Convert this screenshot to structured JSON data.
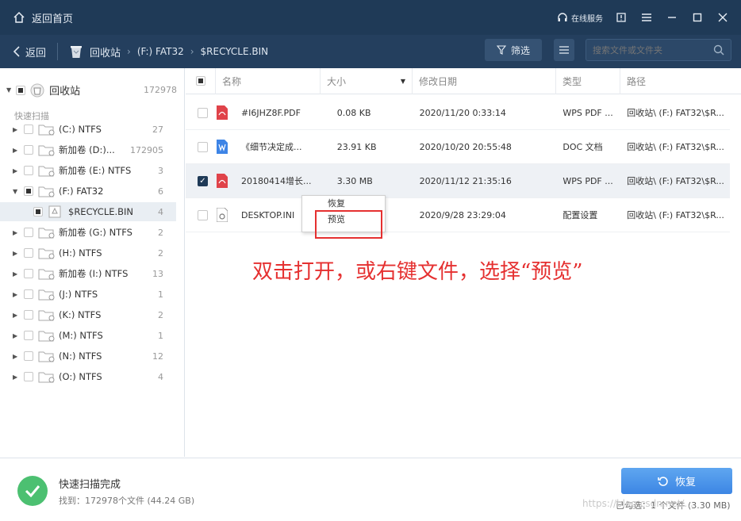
{
  "titlebar": {
    "home_label": "返回首页",
    "service_label": "在线服务"
  },
  "toolbar": {
    "back_label": "返回",
    "crumbs": [
      "回收站",
      "(F:) FAT32",
      "$RECYCLE.BIN"
    ],
    "filter_label": "筛选",
    "search_placeholder": "搜索文件或文件夹"
  },
  "sidebar": {
    "root": {
      "label": "回收站",
      "count": "172978"
    },
    "quick_scan_label": "快速扫描",
    "nodes": [
      {
        "label": "(C:) NTFS",
        "count": "27"
      },
      {
        "label": "新加卷 (D:)...",
        "count": "172905"
      },
      {
        "label": "新加卷 (E:) NTFS",
        "count": "3"
      },
      {
        "label": "(F:) FAT32",
        "count": "6"
      },
      {
        "label": "$RECYCLE.BIN",
        "count": "4"
      },
      {
        "label": "新加卷 (G:) NTFS",
        "count": "2"
      },
      {
        "label": "(H:) NTFS",
        "count": "2"
      },
      {
        "label": "新加卷 (I:) NTFS",
        "count": "13"
      },
      {
        "label": "(J:) NTFS",
        "count": "1"
      },
      {
        "label": "(K:) NTFS",
        "count": "2"
      },
      {
        "label": "(M:) NTFS",
        "count": "1"
      },
      {
        "label": "(N:) NTFS",
        "count": "12"
      },
      {
        "label": "(O:) NTFS",
        "count": "4"
      }
    ]
  },
  "table": {
    "headers": [
      "名称",
      "大小",
      "修改日期",
      "类型",
      "路径"
    ],
    "rows": [
      {
        "name": "#I6JHZ8F.PDF",
        "size": "0.08 KB",
        "date": "2020/11/20 0:33:14",
        "type": "WPS PDF ...",
        "path": "回收站\\ (F:) FAT32\\$R..."
      },
      {
        "name": "《细节决定成...",
        "size": "23.91 KB",
        "date": "2020/10/20 20:55:48",
        "type": "DOC 文档",
        "path": "回收站\\ (F:) FAT32\\$R..."
      },
      {
        "name": "20180414增长...",
        "size": "3.30 MB",
        "date": "2020/11/12 21:35:16",
        "type": "WPS PDF ...",
        "path": "回收站\\ (F:) FAT32\\$R..."
      },
      {
        "name": "DESKTOP.INI",
        "size": "",
        "date": "2020/9/28 23:29:04",
        "type": "配置设置",
        "path": "回收站\\ (F:) FAT32\\$R..."
      }
    ]
  },
  "context_menu": {
    "items": [
      "恢复",
      "预览"
    ]
  },
  "annotation": "双击打开，或右键文件，选择“预览”",
  "footer": {
    "title": "快速扫描完成",
    "found": "找到：172978个文件 (44.24 GB)",
    "restore_label": "恢复",
    "selected": "已勾选：1 个文件 (3.30 MB)"
  },
  "watermark": "https://blog.csdn.net/..."
}
